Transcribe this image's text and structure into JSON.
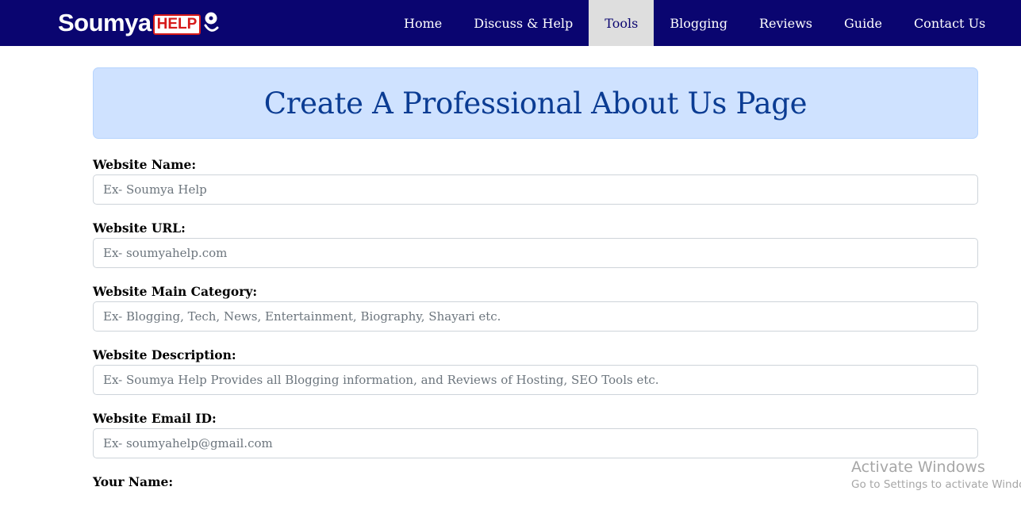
{
  "brand": {
    "name": "Soumya",
    "badge": "HELP"
  },
  "nav": {
    "items": [
      {
        "label": "Home"
      },
      {
        "label": "Discuss & Help"
      },
      {
        "label": "Tools"
      },
      {
        "label": "Blogging"
      },
      {
        "label": "Reviews"
      },
      {
        "label": "Guide"
      },
      {
        "label": "Contact Us"
      }
    ],
    "active": "Tools"
  },
  "page": {
    "title": "Create A Professional About Us Page"
  },
  "form": {
    "fields": [
      {
        "label": "Website Name:",
        "placeholder": "Ex- Soumya Help",
        "value": ""
      },
      {
        "label": "Website URL:",
        "placeholder": "Ex- soumyahelp.com",
        "value": ""
      },
      {
        "label": "Website Main Category:",
        "placeholder": "Ex- Blogging, Tech, News, Entertainment, Biography, Shayari etc.",
        "value": ""
      },
      {
        "label": "Website Description:",
        "placeholder": "Ex- Soumya Help Provides all Blogging information, and Reviews of Hosting, SEO Tools etc.",
        "value": ""
      },
      {
        "label": "Website Email ID:",
        "placeholder": "Ex- soumyahelp@gmail.com",
        "value": ""
      },
      {
        "label": "Your Name:"
      }
    ]
  },
  "watermark": {
    "title": "Activate Windows",
    "subtitle": "Go to Settings to activate Windows."
  },
  "colors": {
    "navbar": "#0a0570",
    "active_tab": "#dedede",
    "hero_bg": "#cfe2ff",
    "hero_text": "#0b3c93",
    "badge_red": "#d61a1a"
  }
}
